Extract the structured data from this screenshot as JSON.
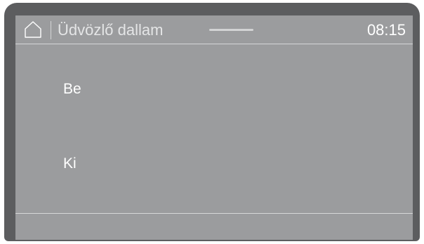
{
  "header": {
    "title": "Üdvözlő dallam",
    "time": "08:15",
    "home_icon": "home-icon"
  },
  "options": [
    {
      "label": "Be"
    },
    {
      "label": "Ki"
    }
  ],
  "colors": {
    "bezel": "#5c5d5f",
    "screen": "#9b9c9e",
    "text": "#ffffff",
    "rule": "#d6d7d8"
  }
}
